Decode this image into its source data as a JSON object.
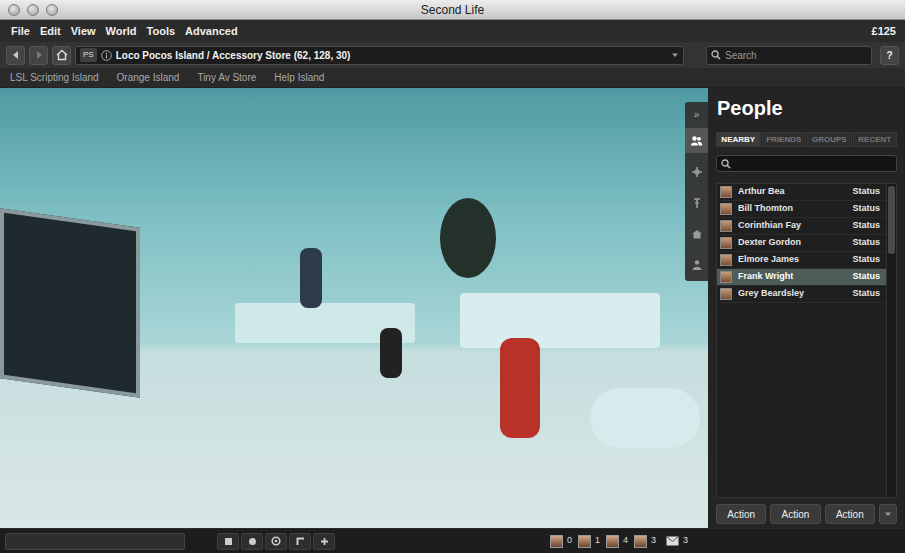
{
  "window": {
    "title": "Second Life"
  },
  "menu": [
    "File",
    "Edit",
    "View",
    "World",
    "Tools",
    "Advanced"
  ],
  "balance": "£125",
  "location": {
    "badge": "PS",
    "text": "Loco Pocos Island / Accessory Store (62, 128, 30)"
  },
  "search": {
    "placeholder": "Search"
  },
  "help": "?",
  "favorites": [
    "LSL Scripting Island",
    "Orange Island",
    "Tiny Av Store",
    "Help Island"
  ],
  "sidebar": {
    "collapse": "»",
    "tabs": [
      {
        "kind": "people",
        "selected": true
      },
      {
        "kind": "places",
        "selected": false
      },
      {
        "kind": "landmarks",
        "selected": false
      },
      {
        "kind": "inventory",
        "selected": false
      },
      {
        "kind": "me",
        "selected": false
      }
    ]
  },
  "panel": {
    "title": "People",
    "tabs": [
      {
        "label": "NEARBY",
        "selected": true
      },
      {
        "label": "FRIENDS",
        "selected": false
      },
      {
        "label": "GROUPS",
        "selected": false
      },
      {
        "label": "RECENT",
        "selected": false
      }
    ],
    "people": [
      {
        "name": "Arthur Bea",
        "status": "Status",
        "selected": false
      },
      {
        "name": "Bill Thomton",
        "status": "Status",
        "selected": false
      },
      {
        "name": "Corinthian Fay",
        "status": "Status",
        "selected": false
      },
      {
        "name": "Dexter Gordon",
        "status": "Status",
        "selected": false
      },
      {
        "name": "Elmore James",
        "status": "Status",
        "selected": false
      },
      {
        "name": "Frank Wright",
        "status": "Status",
        "selected": true
      },
      {
        "name": "Grey Beardsley",
        "status": "Status",
        "selected": false
      }
    ],
    "scrollbar": {
      "level": 0.22
    },
    "actions": [
      "Action",
      "Action",
      "Action"
    ]
  },
  "status_bar": {
    "nearby": [
      {
        "count": "0"
      },
      {
        "count": "1"
      },
      {
        "count": "4"
      },
      {
        "count": "3"
      }
    ],
    "messages": "3"
  }
}
